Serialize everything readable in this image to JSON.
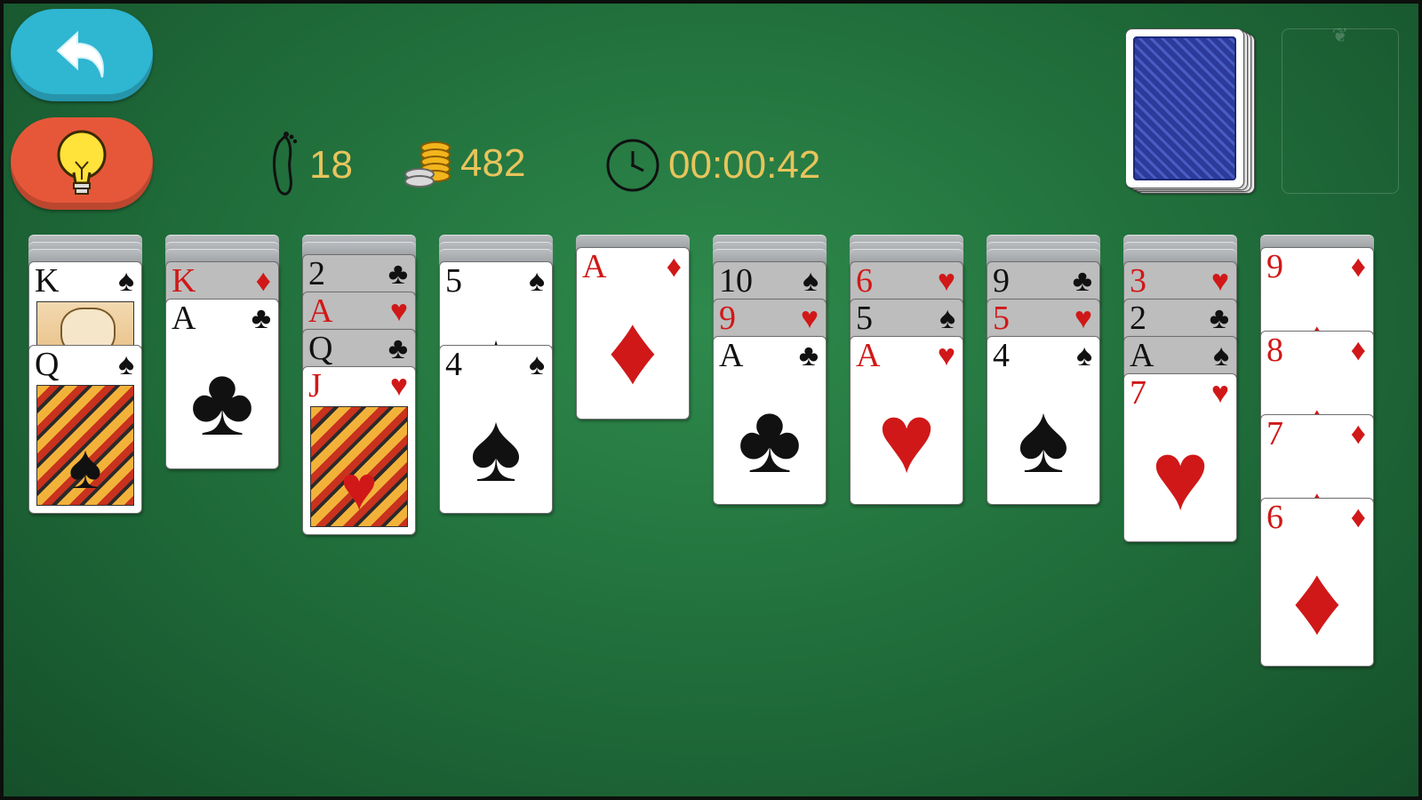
{
  "toolbar": {
    "undo_icon": "undo-arrow-icon",
    "hint_icon": "lightbulb-icon"
  },
  "hud": {
    "moves": "18",
    "coins": "482",
    "timer": "00:00:42"
  },
  "colors": {
    "table": "#1f6b39",
    "undo": "#2fb6d1",
    "hint": "#e6573a",
    "hud_text": "#e8c45c",
    "red_suit": "#d01818"
  },
  "columns": [
    {
      "hidden": 3,
      "cards": [
        {
          "rank": "K",
          "suit": "♠",
          "color": "blk"
        },
        {
          "rank": "Q",
          "suit": "♠",
          "color": "blk"
        }
      ]
    },
    {
      "hidden": 3,
      "cards": [
        {
          "rank": "K",
          "suit": "♦",
          "color": "red"
        },
        {
          "rank": "A",
          "suit": "♣",
          "color": "blk"
        }
      ]
    },
    {
      "hidden": 2,
      "cards": [
        {
          "rank": "2",
          "suit": "♣",
          "color": "blk"
        },
        {
          "rank": "A",
          "suit": "♥",
          "color": "red"
        },
        {
          "rank": "Q",
          "suit": "♣",
          "color": "blk"
        },
        {
          "rank": "J",
          "suit": "♥",
          "color": "red"
        }
      ]
    },
    {
      "hidden": 3,
      "cards": [
        {
          "rank": "5",
          "suit": "♠",
          "color": "blk"
        },
        {
          "rank": "4",
          "suit": "♠",
          "color": "blk"
        }
      ]
    },
    {
      "hidden": 1,
      "cards": [
        {
          "rank": "A",
          "suit": "♦",
          "color": "red"
        }
      ]
    },
    {
      "hidden": 3,
      "cards": [
        {
          "rank": "10",
          "suit": "♠",
          "color": "blk"
        },
        {
          "rank": "9",
          "suit": "♥",
          "color": "red"
        },
        {
          "rank": "A",
          "suit": "♣",
          "color": "blk"
        }
      ]
    },
    {
      "hidden": 3,
      "cards": [
        {
          "rank": "6",
          "suit": "♥",
          "color": "red"
        },
        {
          "rank": "5",
          "suit": "♠",
          "color": "blk"
        },
        {
          "rank": "A",
          "suit": "♥",
          "color": "red"
        }
      ]
    },
    {
      "hidden": 3,
      "cards": [
        {
          "rank": "9",
          "suit": "♣",
          "color": "blk"
        },
        {
          "rank": "5",
          "suit": "♥",
          "color": "red"
        },
        {
          "rank": "4",
          "suit": "♠",
          "color": "blk"
        }
      ]
    },
    {
      "hidden": 3,
      "cards": [
        {
          "rank": "3",
          "suit": "♥",
          "color": "red"
        },
        {
          "rank": "2",
          "suit": "♣",
          "color": "blk"
        },
        {
          "rank": "A",
          "suit": "♠",
          "color": "blk"
        },
        {
          "rank": "7",
          "suit": "♥",
          "color": "red"
        }
      ]
    },
    {
      "hidden": 1,
      "cards": [
        {
          "rank": "9",
          "suit": "♦",
          "color": "red"
        },
        {
          "rank": "8",
          "suit": "♦",
          "color": "red"
        },
        {
          "rank": "7",
          "suit": "♦",
          "color": "red"
        },
        {
          "rank": "6",
          "suit": "♦",
          "color": "red"
        }
      ]
    }
  ]
}
